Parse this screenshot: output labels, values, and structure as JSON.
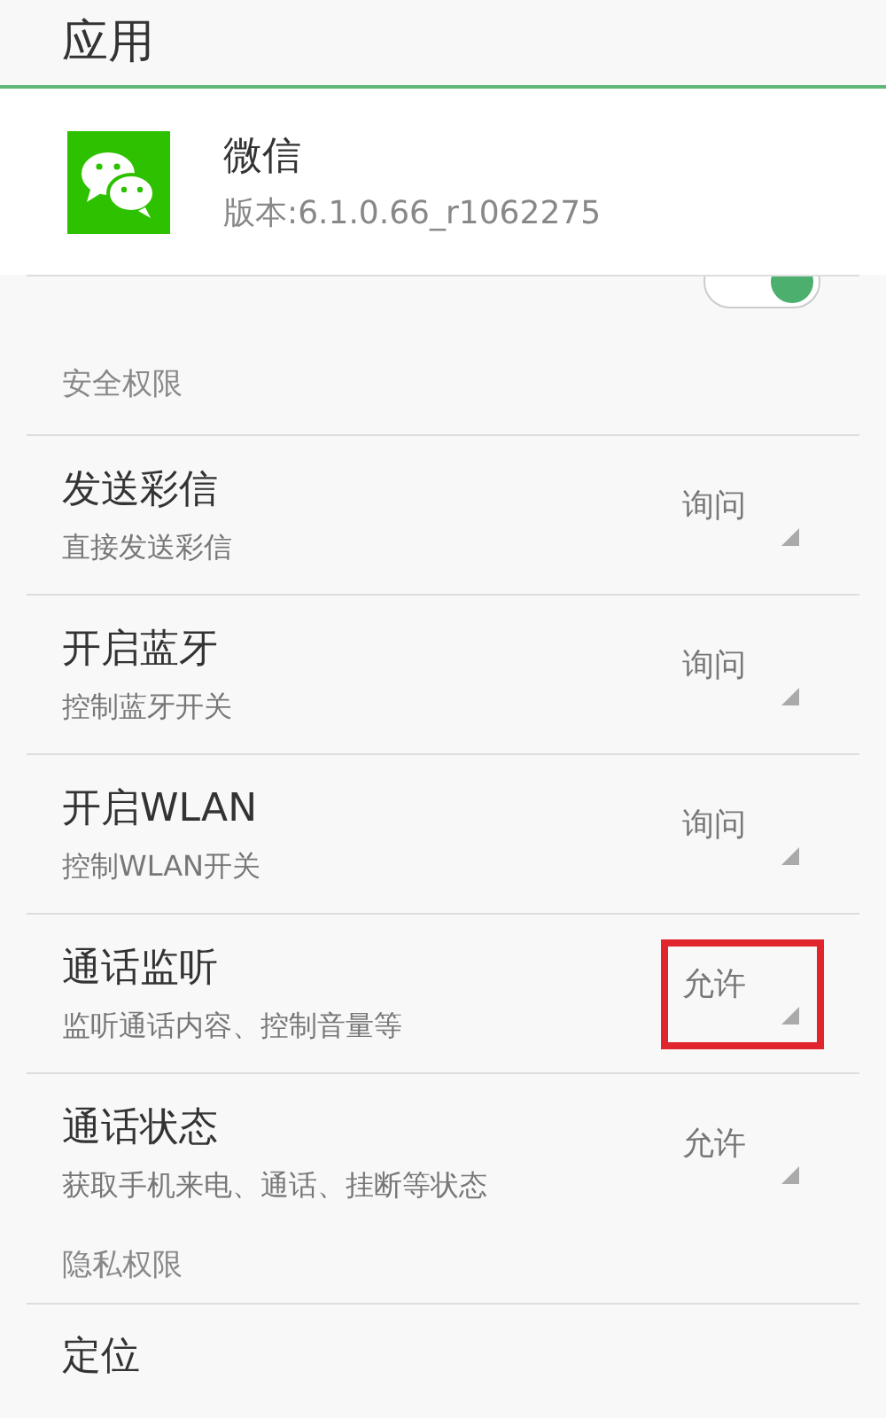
{
  "header": {
    "title": "应用"
  },
  "app": {
    "name": "微信",
    "version": "版本:6.1.0.66_r1062275"
  },
  "partial_row": {
    "on": true
  },
  "sections": [
    {
      "title": "安全权限",
      "items": [
        {
          "title": "发送彩信",
          "subtitle": "直接发送彩信",
          "value": "询问",
          "highlighted": false
        },
        {
          "title": "开启蓝牙",
          "subtitle": "控制蓝牙开关",
          "value": "询问",
          "highlighted": false
        },
        {
          "title": "开启WLAN",
          "subtitle": "控制WLAN开关",
          "value": "询问",
          "highlighted": false
        },
        {
          "title": "通话监听",
          "subtitle": "监听通话内容、控制音量等",
          "value": "允许",
          "highlighted": true
        },
        {
          "title": "通话状态",
          "subtitle": "获取手机来电、通话、挂断等状态",
          "value": "允许",
          "highlighted": false
        }
      ]
    },
    {
      "title": "隐私权限",
      "items": [
        {
          "title": "定位"
        }
      ]
    }
  ]
}
